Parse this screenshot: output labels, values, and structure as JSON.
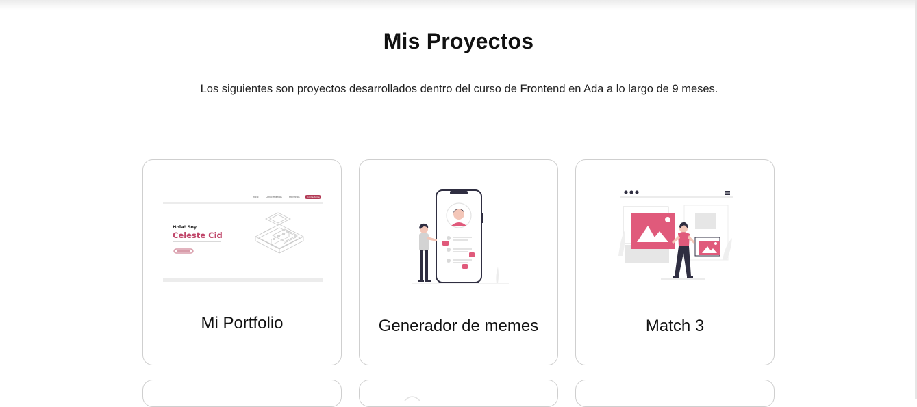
{
  "section": {
    "title": "Mis Proyectos",
    "subtitle": "Los siguientes son proyectos desarrollados dentro del curso de Frontend en Ada a lo largo de 9 meses."
  },
  "projects": [
    {
      "title": "Mi Portfolio",
      "thumbnail": {
        "greeting": "Hola! Soy",
        "name": "Celeste Cid",
        "nav": [
          "Inicio",
          "Conocimientos",
          "Proyectos",
          "Contactame"
        ]
      }
    },
    {
      "title": "Generador de memes"
    },
    {
      "title": "Match 3"
    }
  ],
  "colors": {
    "accent": "#e05a7b",
    "accent_dark": "#b23a55",
    "ink": "#2f2e41",
    "card_border": "#cfcfcf"
  }
}
